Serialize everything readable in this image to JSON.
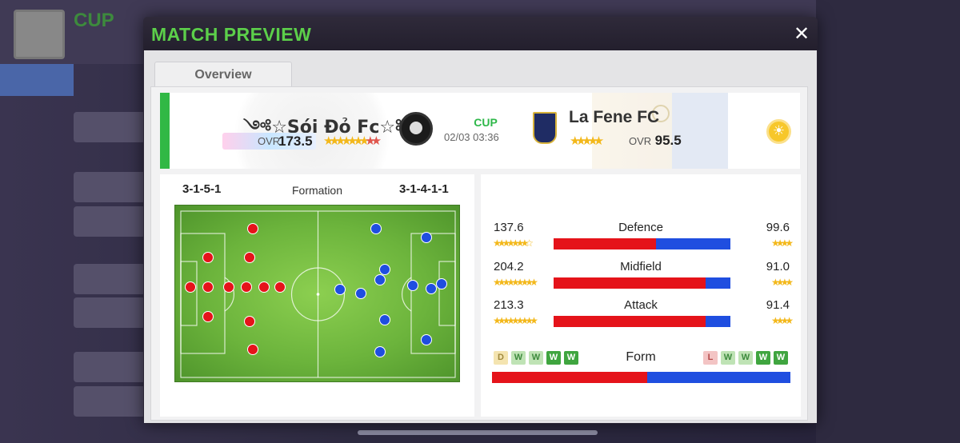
{
  "background": {
    "screen_title": "CUP"
  },
  "modal": {
    "title": "MATCH PREVIEW",
    "close_label": "✕",
    "tabs": [
      {
        "label": "Overview",
        "active": true
      }
    ]
  },
  "match": {
    "competition": "CUP",
    "datetime": "02/03 03:36",
    "weather_icon": "sun-icon",
    "home": {
      "name": "༺☆Sói Đỏ Fc☆༻",
      "ovr_label": "OVR",
      "ovr": "173.5",
      "formation": "3-1-5-1",
      "crest_icon": "skull-crest-icon"
    },
    "away": {
      "name": "La Fene FC",
      "ovr_label": "OVR",
      "ovr": "95.5",
      "formation": "3-1-4-1-1",
      "crest_icon": "la-fene-crest-icon"
    }
  },
  "formation_label": "Formation",
  "stats": [
    {
      "name": "Defence",
      "home": "137.6",
      "away": "99.6",
      "home_share": 0.58
    },
    {
      "name": "Midfield",
      "home": "204.2",
      "away": "91.0",
      "home_share": 0.86
    },
    {
      "name": "Attack",
      "home": "213.3",
      "away": "91.4",
      "home_share": 0.86
    }
  ],
  "form": {
    "label": "Form",
    "home": [
      "D",
      "W",
      "W",
      "W",
      "W"
    ],
    "away": [
      "L",
      "W",
      "W",
      "W",
      "W"
    ],
    "home_share": 0.52
  },
  "colors": {
    "home": "#e5131a",
    "away": "#1f4ee0",
    "accent": "#5ccf4a"
  }
}
